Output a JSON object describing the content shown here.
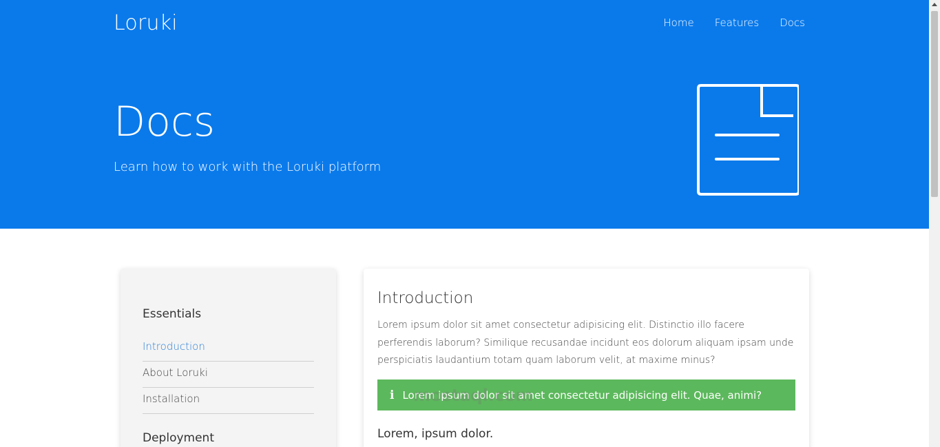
{
  "header": {
    "brand": "Loruki",
    "nav": [
      "Home",
      "Features",
      "Docs"
    ]
  },
  "hero": {
    "title": "Docs",
    "subtitle": "Learn how to work with the Loruki platform",
    "icon": "document-icon"
  },
  "sidebar": {
    "sections": [
      {
        "heading": "Essentials",
        "items": [
          "Introduction",
          "About Loruki",
          "Installation"
        ]
      },
      {
        "heading": "Deployment",
        "items": []
      }
    ],
    "active_item": "Introduction"
  },
  "content": {
    "title": "Introduction",
    "paragraph": "Lorem ipsum dolor sit amet consectetur adipisicing elit. Distinctio illo facere perferendis laborum? Similique recusandae incidunt eos dolorum aliquam ipsam unde perspiciatis laudantium totam quam laborum velit, at maxime minus?",
    "alert_text": "Lorem ipsum dolor sit amet consectetur adipisicing elit. Quae, animi?",
    "alert_icon": "info-icon",
    "subheading": "Lorem, ipsum dolor."
  },
  "colors": {
    "primary": "#0a7aeb",
    "success": "#5cb85c",
    "active_link": "#2d7fd6"
  },
  "watermark": "mostaql.com"
}
